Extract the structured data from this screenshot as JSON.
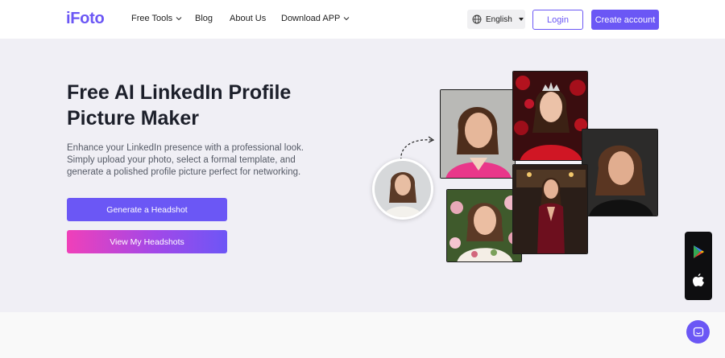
{
  "header": {
    "logo": "iFoto",
    "nav": [
      {
        "label": "Free Tools",
        "has_dropdown": true
      },
      {
        "label": "Blog",
        "has_dropdown": false
      },
      {
        "label": "About Us",
        "has_dropdown": false
      },
      {
        "label": "Download APP",
        "has_dropdown": true
      }
    ],
    "language": "English",
    "login_label": "Login",
    "create_label": "Create account"
  },
  "hero": {
    "title": "Free AI LinkedIn Profile Picture Maker",
    "subtitle": "Enhance your LinkedIn presence with a professional look. Simply upload your photo, select a formal template, and generate a polished profile picture perfect for networking.",
    "primary_button": "Generate a Headshot",
    "secondary_button": "View My Headshots"
  },
  "colors": {
    "brand": "#6b57f5",
    "hero_bg": "#f0eff5",
    "gradient_start": "#f040b9",
    "gradient_end": "#6d56f6"
  },
  "icons": {
    "language": "globe-icon",
    "store_android": "google-play-icon",
    "store_ios": "apple-icon",
    "chat": "chat-icon"
  }
}
